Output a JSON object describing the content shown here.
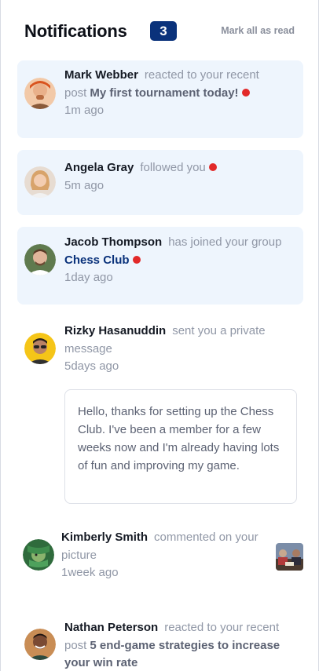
{
  "header": {
    "title": "Notifications",
    "unread_count": "3",
    "mark_all_label": "Mark all as read"
  },
  "notifications": [
    {
      "name": "Mark Webber",
      "action": "reacted to your recent post",
      "post": "My first tournament today!",
      "time": "1m ago",
      "unread": true,
      "avatar_icon": "avatar-mark-webber"
    },
    {
      "name": "Angela Gray",
      "action": "followed you",
      "time": "5m ago",
      "unread": true,
      "avatar_icon": "avatar-angela-gray"
    },
    {
      "name": "Jacob Thompson",
      "action": "has joined your group",
      "group": "Chess Club",
      "time": "1day ago",
      "unread": true,
      "avatar_icon": "avatar-jacob-thompson"
    },
    {
      "name": "Rizky Hasanuddin",
      "action": "sent you a private message",
      "time": "5days ago",
      "unread": false,
      "message": "Hello, thanks for setting up the Chess Club. I've been a member for a few weeks now and I'm already having lots of fun and improving my game.",
      "avatar_icon": "avatar-rizky-hasanuddin"
    },
    {
      "name": "Kimberly Smith",
      "action": "commented on your picture",
      "time": "1week ago",
      "unread": false,
      "avatar_icon": "avatar-kimberly-smith",
      "picture_icon": "chess-picture-thumbnail"
    },
    {
      "name": "Nathan Peterson",
      "action": "reacted to your recent post",
      "post": "5 end-game strategies to increase your win rate",
      "unread": false,
      "avatar_icon": "avatar-nathan-peterson"
    }
  ],
  "colors": {
    "unread_bg": "#eef5fd",
    "badge_bg": "#0a327b",
    "dot_red": "#e22929",
    "group_blue": "#0a327b"
  }
}
